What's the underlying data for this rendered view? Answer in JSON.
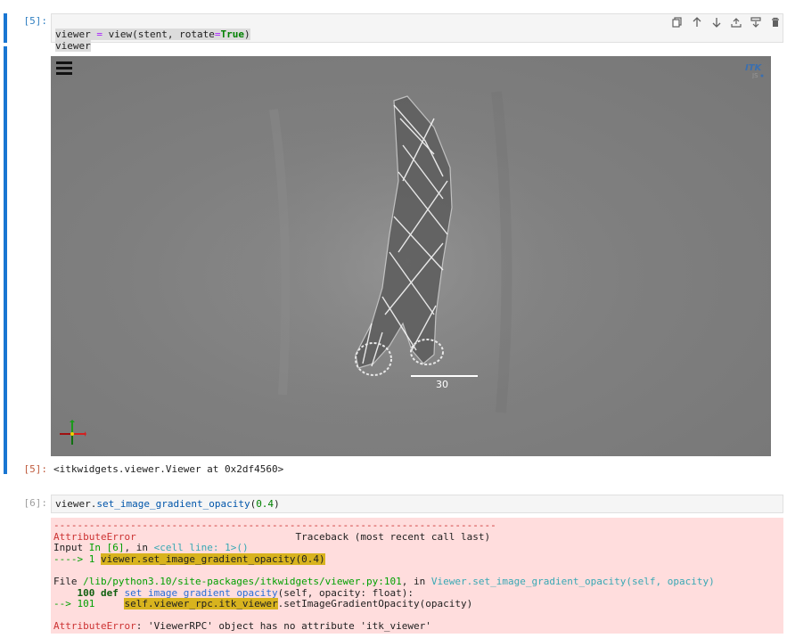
{
  "cell5": {
    "prompt": "[5]:",
    "code_line1_parts": [
      "viewer",
      " = ",
      "view",
      "(stent, rotate",
      "=",
      "True",
      ")"
    ],
    "code_line2": "viewer",
    "output_prompt": "[5]:",
    "output_text": "<itkwidgets.viewer.Viewer at 0x2df4560>"
  },
  "toolbar": {
    "icons": [
      "copy-icon",
      "move-up-icon",
      "move-down-icon",
      "insert-above-icon",
      "insert-below-icon",
      "delete-icon"
    ]
  },
  "viewer": {
    "scale_bar_label": "30",
    "logo_text": "ITK",
    "logo_subtext": "JS"
  },
  "cell6": {
    "prompt": "[6]:",
    "code_obj": "viewer",
    "code_dot": ".",
    "code_method": "set_image_gradient_opacity",
    "code_open": "(",
    "code_arg": "0.4",
    "code_close": ")"
  },
  "error": {
    "dashes": "---------------------------------------------------------------------------",
    "name": "AttributeError",
    "traceback_header": "                           Traceback (most recent call last)",
    "input_prefix": "Input ",
    "input_in": "In [6]",
    "input_mid": ", in ",
    "input_loc": "<cell line: 1>()",
    "arrow1": "----> 1 ",
    "arrow1_code": "viewer.set_image_gradient_opacity(0.4)",
    "file_prefix": "File ",
    "file_path": "/lib/python3.10/site-packages/itkwidgets/viewer.py:101",
    "file_mid": ", in ",
    "file_func": "Viewer.set_image_gradient_opacity(self, opacity)",
    "line100_num": "    100 ",
    "line100_def": "def ",
    "line100_name": "set_image_gradient_opacity",
    "line100_rest": "(self, opacity: float):",
    "arrow101": "--> 101 ",
    "arrow101_pad": "    ",
    "arrow101_hl": "self.viewer_rpc.itk_viewer",
    "arrow101_rest": ".setImageGradientOpacity(opacity)",
    "final_name": "AttributeError",
    "final_msg": ": 'ViewerRPC' object has no attribute 'itk_viewer'"
  }
}
